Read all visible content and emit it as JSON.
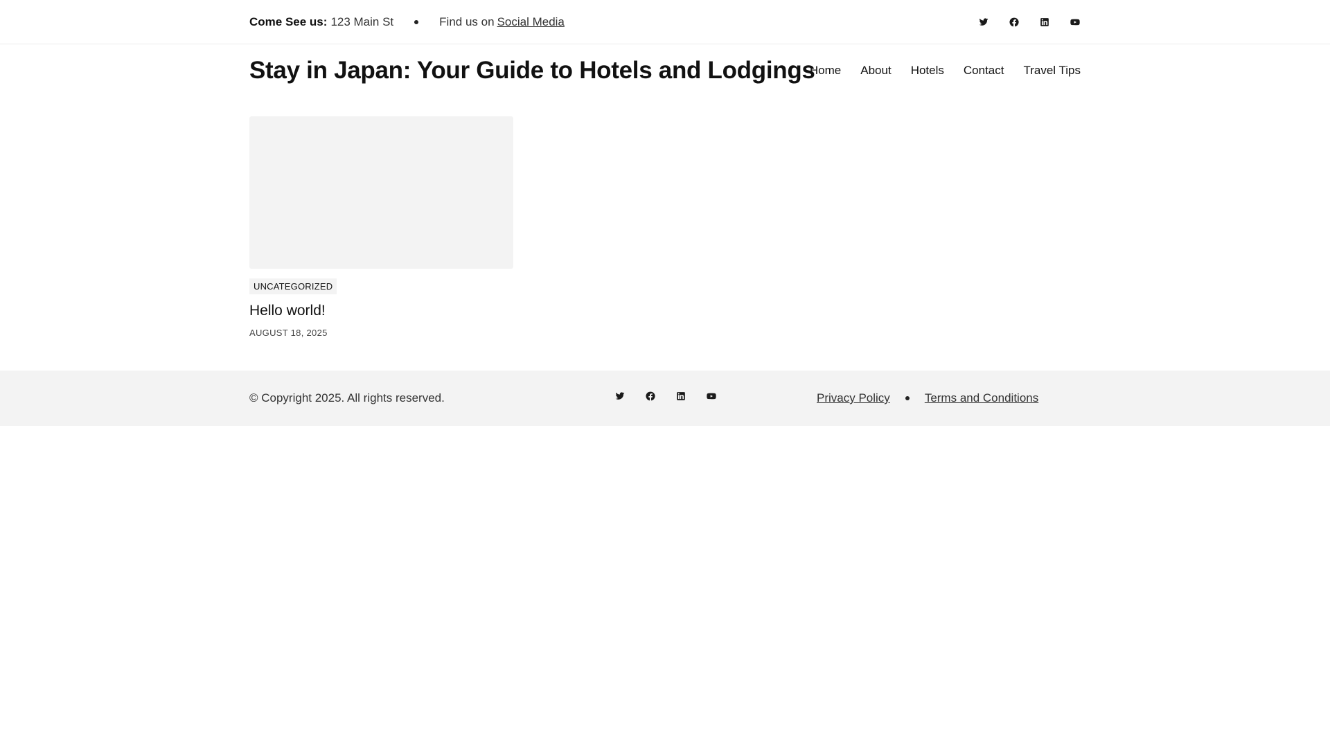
{
  "topbar": {
    "contact_label": "Come See us:",
    "contact_value": "123 Main St",
    "find_text": "Find us on",
    "find_link": "Social Media",
    "social_icons": [
      "twitter-icon",
      "facebook-icon",
      "linkedin-icon",
      "youtube-icon"
    ]
  },
  "header": {
    "site_title": "Stay in Japan: Your Guide to Hotels and Lodgings",
    "nav": [
      "Home",
      "About",
      "Hotels",
      "Contact",
      "Travel Tips"
    ]
  },
  "posts": [
    {
      "category": "UNCATEGORIZED",
      "title": "Hello world!",
      "date": "AUGUST 18, 2025"
    }
  ],
  "footer": {
    "copyright": "© Copyright 2025. All rights reserved.",
    "social_icons": [
      "twitter-icon",
      "facebook-icon",
      "linkedin-icon",
      "youtube-icon"
    ],
    "links": [
      "Privacy Policy",
      "Terms and Conditions"
    ]
  },
  "colors": {
    "text": "#111111",
    "muted": "#333333",
    "panel": "#f3f3f3",
    "border": "#ececec"
  }
}
